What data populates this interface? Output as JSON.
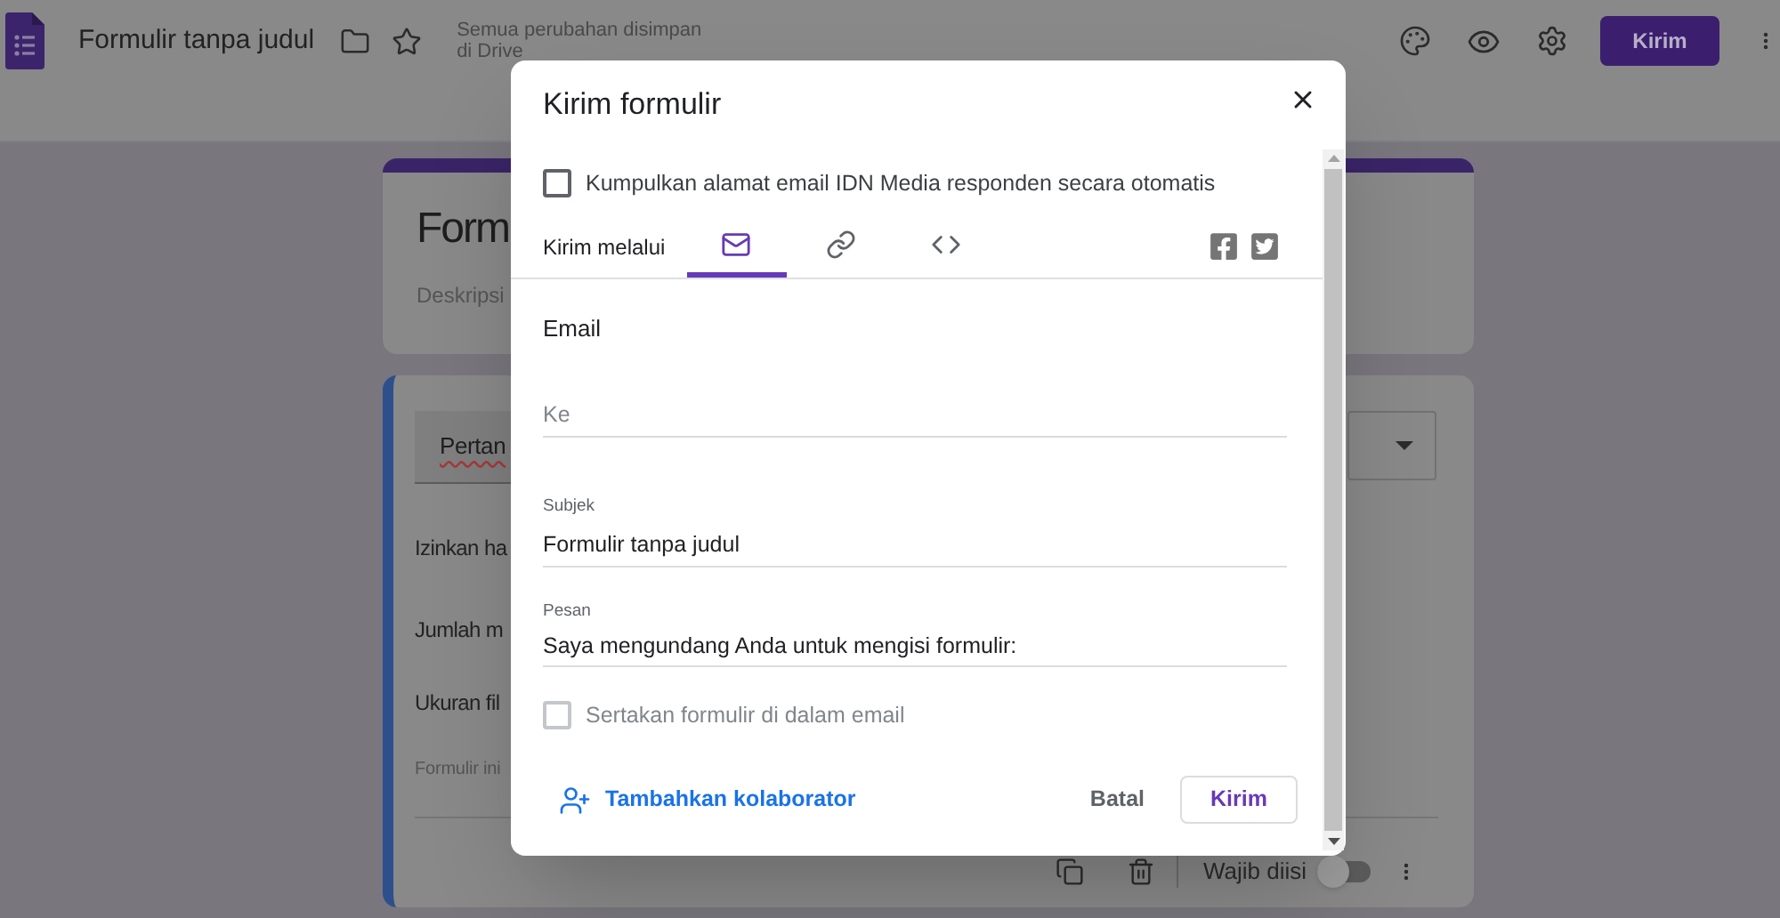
{
  "app_bar": {
    "title": "Formulir tanpa judul",
    "save_status": "Semua perubahan disimpan di Drive",
    "send_button": "Kirim"
  },
  "form": {
    "title": "Form",
    "description": "Deskripsi",
    "question": {
      "title": "Pertan",
      "settings": [
        "Izinkan ha",
        "Jumlah m",
        "Ukuran fil"
      ],
      "note": "Formulir ini",
      "required_label": "Wajib diisi",
      "required": false
    }
  },
  "dialog": {
    "title": "Kirim formulir",
    "collect_emails": {
      "label": "Kumpulkan alamat email IDN Media responden secara otomatis",
      "checked": false
    },
    "send_via_label": "Kirim melalui",
    "tabs": [
      {
        "kind": "email",
        "selected": true
      },
      {
        "kind": "link",
        "selected": false
      },
      {
        "kind": "embed",
        "selected": false
      }
    ],
    "section_title": "Email",
    "to_field": {
      "placeholder": "Ke"
    },
    "subject_field": {
      "label": "Subjek",
      "value": "Formulir tanpa judul"
    },
    "message_field": {
      "label": "Pesan",
      "value": "Saya mengundang Anda untuk mengisi formulir:"
    },
    "include_form": {
      "label": "Sertakan formulir di dalam email",
      "checked": false,
      "disabled": true
    },
    "add_collaborators": "Tambahkan kolaborator",
    "cancel_button": "Batal",
    "send_button": "Kirim"
  }
}
